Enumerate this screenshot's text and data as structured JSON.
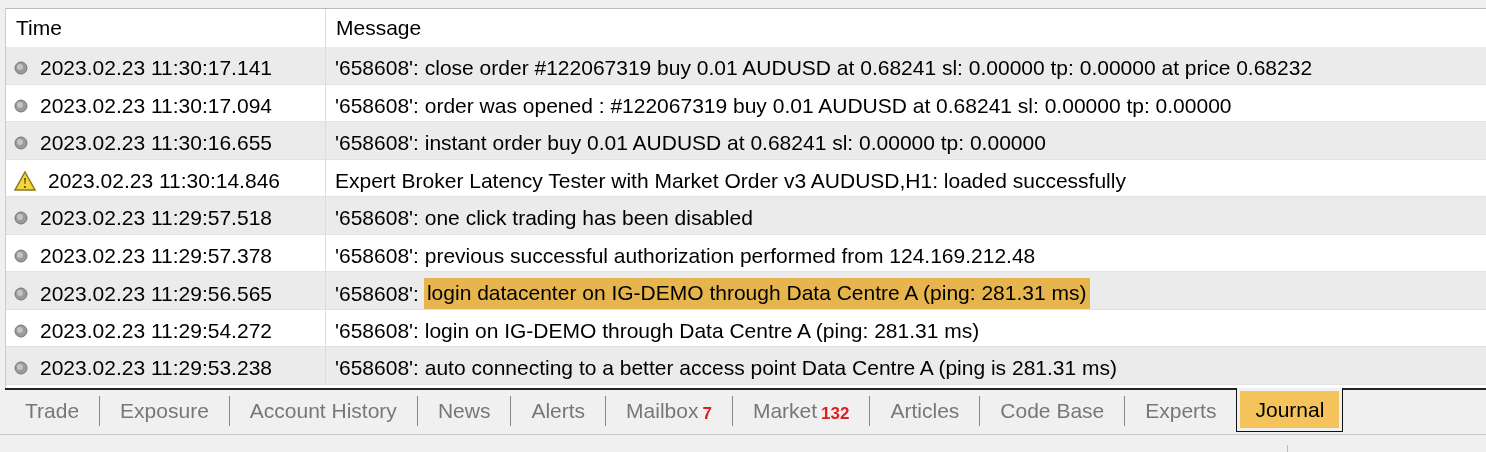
{
  "table": {
    "columns": [
      "Time",
      "Message"
    ],
    "rows": [
      {
        "kind": "info",
        "time": "2023.02.23 11:30:17.141",
        "message": "'658608': close order #122067319 buy 0.01 AUDUSD at 0.68241 sl: 0.00000 tp: 0.00000 at price 0.68232"
      },
      {
        "kind": "info",
        "time": "2023.02.23 11:30:17.094",
        "message": "'658608': order was opened : #122067319 buy 0.01 AUDUSD at 0.68241 sl: 0.00000 tp: 0.00000"
      },
      {
        "kind": "info",
        "time": "2023.02.23 11:30:16.655",
        "message": "'658608': instant order buy 0.01 AUDUSD at 0.68241 sl: 0.00000 tp: 0.00000"
      },
      {
        "kind": "warning",
        "time": "2023.02.23 11:30:14.846",
        "message": "Expert Broker Latency Tester with Market Order v3 AUDUSD,H1: loaded successfully"
      },
      {
        "kind": "info",
        "time": "2023.02.23 11:29:57.518",
        "message": "'658608': one click trading has been disabled"
      },
      {
        "kind": "info",
        "time": "2023.02.23 11:29:57.378",
        "message": "'658608': previous successful authorization performed from 124.169.212.48"
      },
      {
        "kind": "info",
        "time": "2023.02.23 11:29:56.565",
        "message": "'658608':",
        "selection": "login datacenter on IG-DEMO through Data Centre A (ping: 281.31 ms)"
      },
      {
        "kind": "info",
        "time": "2023.02.23 11:29:54.272",
        "message": "'658608': login on IG-DEMO through Data Centre A (ping: 281.31 ms)"
      },
      {
        "kind": "info",
        "time": "2023.02.23 11:29:53.238",
        "message": "'658608': auto connecting to a better access point Data Centre A (ping is 281.31 ms)"
      }
    ]
  },
  "tabs": [
    {
      "label": "Trade",
      "selected": false
    },
    {
      "label": "Exposure",
      "selected": false
    },
    {
      "label": "Account History",
      "selected": false
    },
    {
      "label": "News",
      "selected": false
    },
    {
      "label": "Alerts",
      "selected": false
    },
    {
      "label": "Mailbox",
      "badge": "7",
      "selected": false
    },
    {
      "label": "Market",
      "badge": "132",
      "selected": false
    },
    {
      "label": "Articles",
      "selected": false
    },
    {
      "label": "Code Base",
      "selected": false
    },
    {
      "label": "Experts",
      "selected": false
    },
    {
      "label": "Journal",
      "selected": true
    }
  ]
}
